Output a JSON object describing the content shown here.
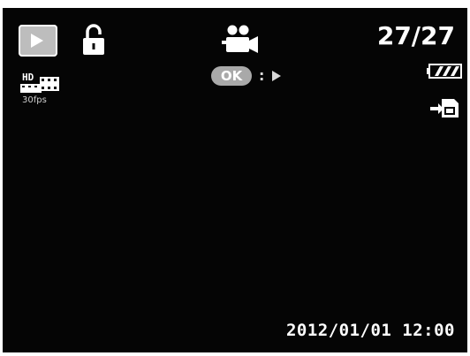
{
  "status": {
    "mode_icon": "play-icon",
    "protect_icon": "lock-icon",
    "record_mode_icon": "video-camera-icon",
    "counter": "27/27",
    "battery_icon": "battery-icon",
    "battery_level": 1.0,
    "storage_icon": "internal-memory-icon"
  },
  "hint": {
    "button_label": "OK",
    "separator": ":",
    "action_icon": "play-arrow-icon"
  },
  "video": {
    "resolution_label": "HD",
    "fps_label": "30fps"
  },
  "footer": {
    "datetime": "2012/01/01 12:00"
  },
  "colors": {
    "background": "#050505",
    "foreground": "#ffffff",
    "badge": "#bdbdbd"
  }
}
